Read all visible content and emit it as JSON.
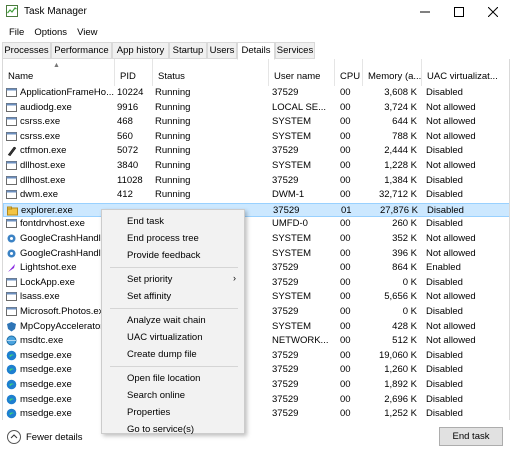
{
  "window": {
    "title": "Task Manager"
  },
  "menubar": [
    "File",
    "Options",
    "View"
  ],
  "tabs": [
    {
      "label": "Processes",
      "active": false
    },
    {
      "label": "Performance",
      "active": false
    },
    {
      "label": "App history",
      "active": false
    },
    {
      "label": "Startup",
      "active": false
    },
    {
      "label": "Users",
      "active": false
    },
    {
      "label": "Details",
      "active": true
    },
    {
      "label": "Services",
      "active": false
    }
  ],
  "columns": [
    "Name",
    "PID",
    "Status",
    "User name",
    "CPU",
    "Memory (a...",
    "UAC virtualizat..."
  ],
  "rows": [
    {
      "icon": "app-window-icon",
      "name": "ApplicationFrameHo...",
      "pid": "10224",
      "status": "Running",
      "user": "37529",
      "cpu": "00",
      "memory": "3,608 K",
      "uac": "Disabled"
    },
    {
      "icon": "app-window-icon",
      "name": "audiodg.exe",
      "pid": "9916",
      "status": "Running",
      "user": "LOCAL SE...",
      "cpu": "00",
      "memory": "3,724 K",
      "uac": "Not allowed"
    },
    {
      "icon": "app-window-icon",
      "name": "csrss.exe",
      "pid": "468",
      "status": "Running",
      "user": "SYSTEM",
      "cpu": "00",
      "memory": "644 K",
      "uac": "Not allowed"
    },
    {
      "icon": "app-window-icon",
      "name": "csrss.exe",
      "pid": "560",
      "status": "Running",
      "user": "SYSTEM",
      "cpu": "00",
      "memory": "788 K",
      "uac": "Not allowed"
    },
    {
      "icon": "pen-icon",
      "name": "ctfmon.exe",
      "pid": "5072",
      "status": "Running",
      "user": "37529",
      "cpu": "00",
      "memory": "2,444 K",
      "uac": "Disabled"
    },
    {
      "icon": "app-window-icon",
      "name": "dllhost.exe",
      "pid": "3840",
      "status": "Running",
      "user": "SYSTEM",
      "cpu": "00",
      "memory": "1,228 K",
      "uac": "Not allowed"
    },
    {
      "icon": "app-window-icon",
      "name": "dllhost.exe",
      "pid": "11028",
      "status": "Running",
      "user": "37529",
      "cpu": "00",
      "memory": "1,384 K",
      "uac": "Disabled"
    },
    {
      "icon": "app-window-icon",
      "name": "dwm.exe",
      "pid": "412",
      "status": "Running",
      "user": "DWM-1",
      "cpu": "00",
      "memory": "32,712 K",
      "uac": "Disabled"
    },
    {
      "icon": "folder-icon",
      "name": "explorer.exe",
      "pid": "",
      "status": "",
      "user": "37529",
      "cpu": "01",
      "memory": "27,876 K",
      "uac": "Disabled",
      "selected": true
    },
    {
      "icon": "app-window-icon",
      "name": "fontdrvhost.exe",
      "pid": "",
      "status": "",
      "user": "UMFD-0",
      "cpu": "00",
      "memory": "260 K",
      "uac": "Disabled"
    },
    {
      "icon": "gear-icon",
      "name": "GoogleCrashHandle",
      "pid": "",
      "status": "",
      "user": "SYSTEM",
      "cpu": "00",
      "memory": "352 K",
      "uac": "Not allowed"
    },
    {
      "icon": "gear-icon",
      "name": "GoogleCrashHandle",
      "pid": "",
      "status": "",
      "user": "SYSTEM",
      "cpu": "00",
      "memory": "396 K",
      "uac": "Not allowed"
    },
    {
      "icon": "feather-icon",
      "name": "Lightshot.exe",
      "pid": "",
      "status": "",
      "user": "37529",
      "cpu": "00",
      "memory": "864 K",
      "uac": "Enabled"
    },
    {
      "icon": "app-window-icon",
      "name": "LockApp.exe",
      "pid": "",
      "status": "",
      "user": "37529",
      "cpu": "00",
      "memory": "0 K",
      "uac": "Disabled"
    },
    {
      "icon": "app-window-icon",
      "name": "lsass.exe",
      "pid": "",
      "status": "",
      "user": "SYSTEM",
      "cpu": "00",
      "memory": "5,656 K",
      "uac": "Not allowed"
    },
    {
      "icon": "app-window-icon",
      "name": "Microsoft.Photos.ex",
      "pid": "",
      "status": "",
      "user": "37529",
      "cpu": "00",
      "memory": "0 K",
      "uac": "Disabled"
    },
    {
      "icon": "shield-icon",
      "name": "MpCopyAccelerator",
      "pid": "",
      "status": "",
      "user": "SYSTEM",
      "cpu": "00",
      "memory": "428 K",
      "uac": "Not allowed"
    },
    {
      "icon": "globe-icon",
      "name": "msdtc.exe",
      "pid": "",
      "status": "",
      "user": "NETWORK...",
      "cpu": "00",
      "memory": "512 K",
      "uac": "Not allowed"
    },
    {
      "icon": "edge-icon",
      "name": "msedge.exe",
      "pid": "",
      "status": "",
      "user": "37529",
      "cpu": "00",
      "memory": "19,060 K",
      "uac": "Disabled"
    },
    {
      "icon": "edge-icon",
      "name": "msedge.exe",
      "pid": "",
      "status": "",
      "user": "37529",
      "cpu": "00",
      "memory": "1,260 K",
      "uac": "Disabled"
    },
    {
      "icon": "edge-icon",
      "name": "msedge.exe",
      "pid": "",
      "status": "",
      "user": "37529",
      "cpu": "00",
      "memory": "1,892 K",
      "uac": "Disabled"
    },
    {
      "icon": "edge-icon",
      "name": "msedge.exe",
      "pid": "",
      "status": "",
      "user": "37529",
      "cpu": "00",
      "memory": "2,696 K",
      "uac": "Disabled"
    },
    {
      "icon": "edge-icon",
      "name": "msedge.exe",
      "pid": "",
      "status": "",
      "user": "37529",
      "cpu": "00",
      "memory": "1,252 K",
      "uac": "Disabled"
    }
  ],
  "context_menu": {
    "groups": [
      [
        {
          "label": "End task"
        },
        {
          "label": "End process tree"
        },
        {
          "label": "Provide feedback"
        }
      ],
      [
        {
          "label": "Set priority",
          "submenu": true
        },
        {
          "label": "Set affinity"
        }
      ],
      [
        {
          "label": "Analyze wait chain"
        },
        {
          "label": "UAC virtualization"
        },
        {
          "label": "Create dump file"
        }
      ],
      [
        {
          "label": "Open file location"
        },
        {
          "label": "Search online"
        },
        {
          "label": "Properties"
        },
        {
          "label": "Go to service(s)"
        }
      ]
    ]
  },
  "footer": {
    "fewer_details": "Fewer details",
    "end_task": "End task"
  },
  "colors": {
    "selection": "#cce8ff",
    "selection_border": "#99d1ff",
    "menu_bg": "#f2f2f2",
    "edge_blue": "#1e7fd0"
  }
}
